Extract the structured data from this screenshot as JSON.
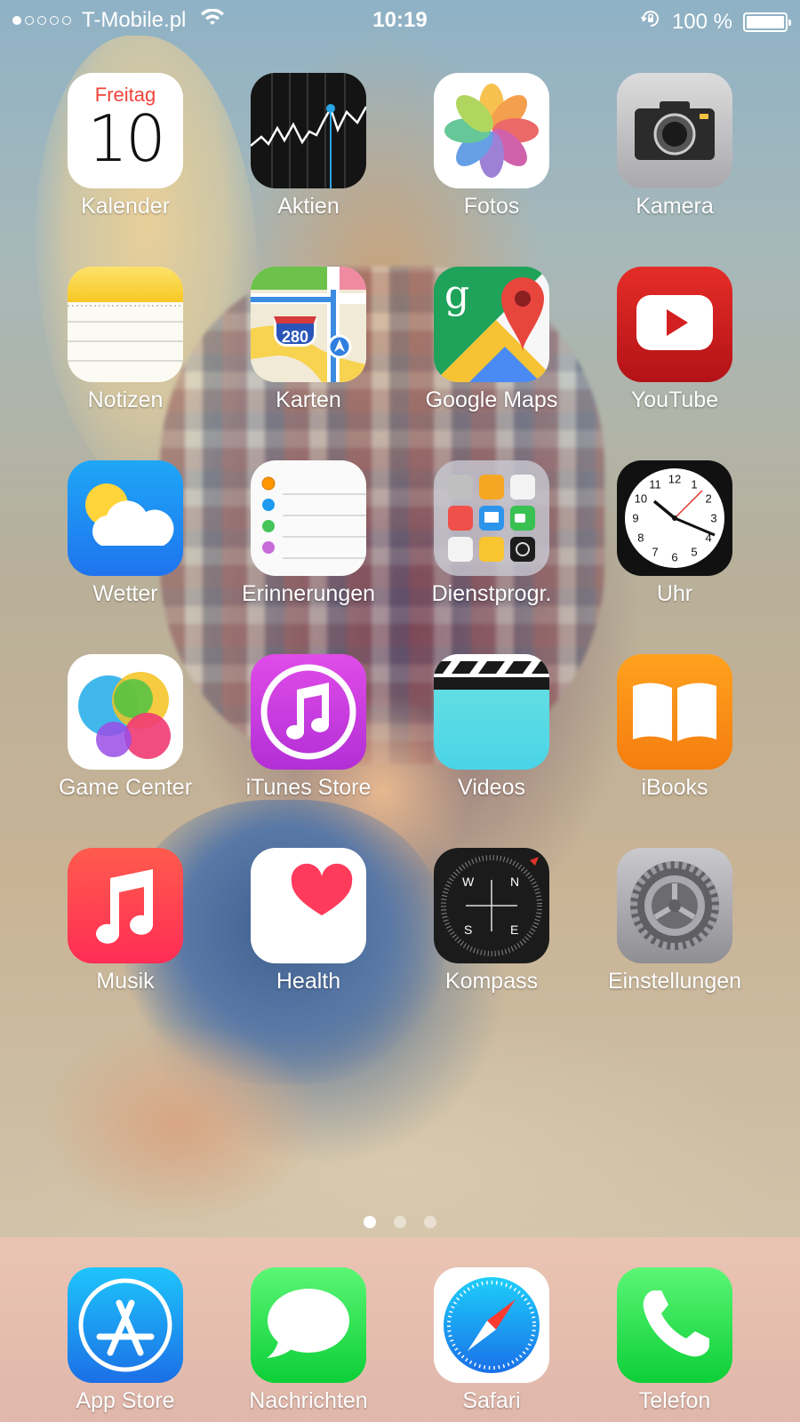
{
  "status": {
    "carrier": "T-Mobile.pl",
    "time": "10:19",
    "battery": "100 %",
    "signal_bars": 1
  },
  "apps": [
    {
      "label": "Kalender",
      "icon": "calendar-icon",
      "day": "Freitag",
      "date": "10"
    },
    {
      "label": "Aktien",
      "icon": "stocks-icon"
    },
    {
      "label": "Fotos",
      "icon": "photos-icon"
    },
    {
      "label": "Kamera",
      "icon": "camera-icon"
    },
    {
      "label": "Notizen",
      "icon": "notes-icon"
    },
    {
      "label": "Karten",
      "icon": "maps-icon",
      "shield": "280"
    },
    {
      "label": "Google Maps",
      "icon": "google-maps-icon",
      "glyph": "g"
    },
    {
      "label": "YouTube",
      "icon": "youtube-icon"
    },
    {
      "label": "Wetter",
      "icon": "weather-icon"
    },
    {
      "label": "Erinnerungen",
      "icon": "reminders-icon"
    },
    {
      "label": "Dienstprogr.",
      "icon": "utilities-folder-icon"
    },
    {
      "label": "Uhr",
      "icon": "clock-icon"
    },
    {
      "label": "Game Center",
      "icon": "game-center-icon"
    },
    {
      "label": "iTunes Store",
      "icon": "itunes-store-icon"
    },
    {
      "label": "Videos",
      "icon": "videos-icon"
    },
    {
      "label": "iBooks",
      "icon": "ibooks-icon"
    },
    {
      "label": "Musik",
      "icon": "music-icon"
    },
    {
      "label": "Health",
      "icon": "health-icon"
    },
    {
      "label": "Kompass",
      "icon": "compass-icon",
      "dirs": [
        "W",
        "N",
        "S",
        "E"
      ]
    },
    {
      "label": "Einstellungen",
      "icon": "settings-icon"
    }
  ],
  "dock": [
    {
      "label": "App Store",
      "icon": "app-store-icon"
    },
    {
      "label": "Nachrichten",
      "icon": "messages-icon"
    },
    {
      "label": "Safari",
      "icon": "safari-icon"
    },
    {
      "label": "Telefon",
      "icon": "phone-icon"
    }
  ],
  "pages": {
    "count": 3,
    "current": 1
  },
  "clock_numbers": [
    "12",
    "1",
    "2",
    "3",
    "4",
    "5",
    "6",
    "7",
    "8",
    "9",
    "10",
    "11"
  ]
}
